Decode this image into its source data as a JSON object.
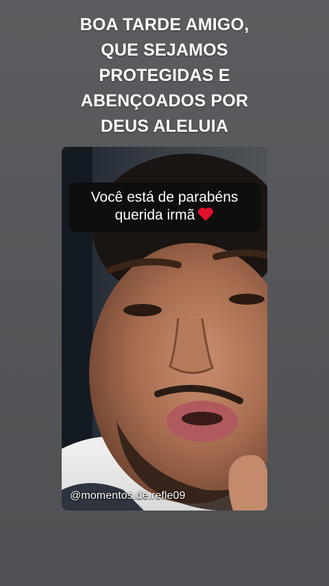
{
  "headline": {
    "lines": [
      "BOA TARDE AMIGO,",
      "QUE SEJAMOS",
      "PROTEGIDAS E",
      "ABENÇOADOS POR",
      "DEUS ALELUIA"
    ]
  },
  "video": {
    "caption": {
      "line1": "Você está de parabéns",
      "line2": "querida irmã",
      "icon": "red-heart-icon"
    },
    "watermark": "@momentos.de.refle09"
  },
  "colors": {
    "background": "#56575a",
    "caption_box": "#0e0e0e",
    "heart": "#e0112b",
    "text": "#ffffff"
  }
}
